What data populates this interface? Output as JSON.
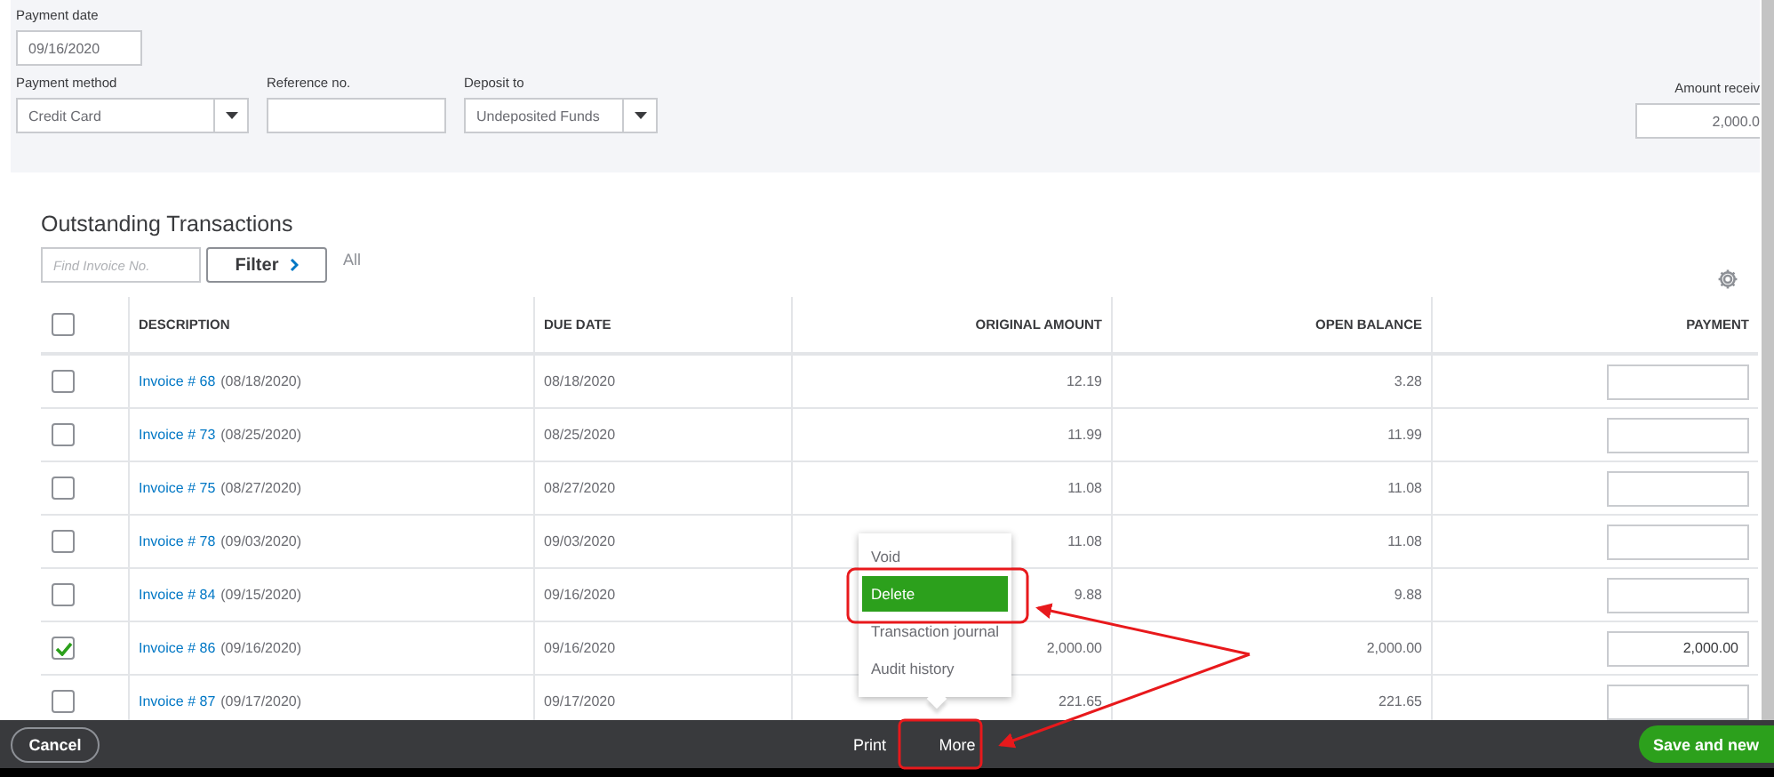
{
  "payment_form": {
    "payment_date": {
      "label": "Payment date",
      "value": "09/16/2020"
    },
    "payment_method": {
      "label": "Payment method",
      "value": "Credit Card"
    },
    "reference_no": {
      "label": "Reference no."
    },
    "deposit_to": {
      "label": "Deposit to",
      "value": "Undeposited Funds"
    },
    "amount_received": {
      "label": "Amount receiv",
      "value": "2,000.0"
    }
  },
  "outstanding": {
    "title": "Outstanding Transactions",
    "search": {
      "placeholder": "Find Invoice No."
    },
    "filter_button": "Filter",
    "filter_value": "All",
    "select_all": {
      "checked": false
    },
    "columns": [
      "DESCRIPTION",
      "DUE DATE",
      "ORIGINAL AMOUNT",
      "OPEN BALANCE",
      "PAYMENT"
    ],
    "rows": [
      {
        "invoice": "Invoice # 68",
        "date": "(08/18/2020)",
        "due_date": "08/18/2020",
        "original_amount": "12.19",
        "open_balance": "3.28",
        "payment": "",
        "checked": false
      },
      {
        "invoice": "Invoice # 73",
        "date": "(08/25/2020)",
        "due_date": "08/25/2020",
        "original_amount": "11.99",
        "open_balance": "11.99",
        "payment": "",
        "checked": false
      },
      {
        "invoice": "Invoice # 75",
        "date": "(08/27/2020)",
        "due_date": "08/27/2020",
        "original_amount": "11.08",
        "open_balance": "11.08",
        "payment": "",
        "checked": false
      },
      {
        "invoice": "Invoice # 78",
        "date": "(09/03/2020)",
        "due_date": "09/03/2020",
        "original_amount": "11.08",
        "open_balance": "11.08",
        "payment": "",
        "checked": false
      },
      {
        "invoice": "Invoice # 84",
        "date": "(09/15/2020)",
        "due_date": "09/16/2020",
        "original_amount": "9.88",
        "open_balance": "9.88",
        "payment": "",
        "checked": false
      },
      {
        "invoice": "Invoice # 86",
        "date": "(09/16/2020)",
        "due_date": "09/16/2020",
        "original_amount": "2,000.00",
        "open_balance": "2,000.00",
        "payment": "2,000.00",
        "checked": true
      },
      {
        "invoice": "Invoice # 87",
        "date": "(09/17/2020)",
        "due_date": "09/17/2020",
        "original_amount": "221.65",
        "open_balance": "221.65",
        "payment": "",
        "checked": false
      }
    ]
  },
  "more_menu": {
    "items": [
      {
        "label": "Void",
        "selected": false
      },
      {
        "label": "Delete",
        "selected": true
      },
      {
        "label": "Transaction journal",
        "selected": false
      },
      {
        "label": "Audit history",
        "selected": false
      }
    ]
  },
  "footer": {
    "cancel": "Cancel",
    "print": "Print",
    "more": "More",
    "save": "Save and new"
  }
}
